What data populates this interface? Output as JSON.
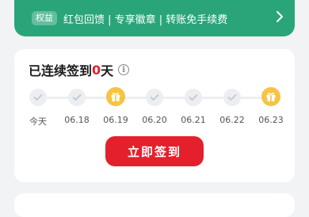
{
  "banner": {
    "badge": "权益",
    "text": "红包回馈 | 专享徽章 | 转账免手续费",
    "arrow_icon": "chevron-right-icon"
  },
  "checkin": {
    "title_prefix": "已连续签到",
    "days": "0",
    "title_suffix": "天",
    "info_icon": "info-icon",
    "info_glyph": "i",
    "days_list": [
      {
        "label": "今天",
        "type": "check"
      },
      {
        "label": "06.18",
        "type": "check"
      },
      {
        "label": "06.19",
        "type": "gift"
      },
      {
        "label": "06.20",
        "type": "check"
      },
      {
        "label": "06.21",
        "type": "check"
      },
      {
        "label": "06.22",
        "type": "check"
      },
      {
        "label": "06.23",
        "type": "gift"
      }
    ],
    "button_label": "立即签到"
  },
  "colors": {
    "banner_green": "#2aa57a",
    "accent_red": "#e5202d",
    "gift_yellow": "#f6c343",
    "inactive_gray": "#eceef1"
  }
}
